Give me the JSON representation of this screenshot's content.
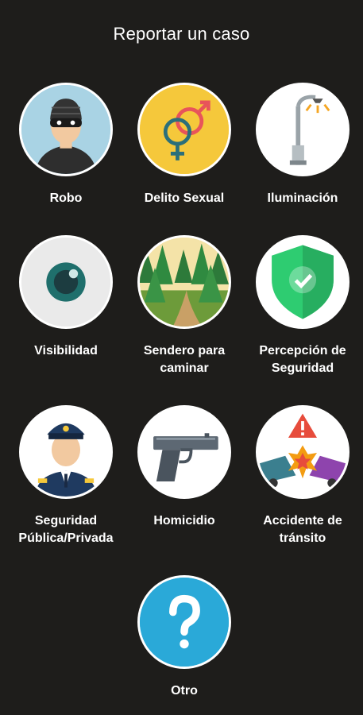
{
  "page": {
    "title": "Reportar un caso"
  },
  "categories": [
    {
      "label": "Robo",
      "icon": "thief-icon",
      "bg": "#a9d3e4"
    },
    {
      "label": "Delito Sexual",
      "icon": "gender-symbols-icon",
      "bg": "#f5c83b"
    },
    {
      "label": "Iluminación",
      "icon": "street-lamp-icon",
      "bg": "#ffffff"
    },
    {
      "label": "Visibilidad",
      "icon": "eye-icon",
      "bg": "#eaeaea"
    },
    {
      "label": "Sendero para\ncaminar",
      "icon": "forest-path-icon",
      "bg": "#f2d89a"
    },
    {
      "label": "Percepción de\nSeguridad",
      "icon": "shield-check-icon",
      "bg": "#ffffff"
    },
    {
      "label": "Seguridad\nPública/Privada",
      "icon": "police-officer-icon",
      "bg": "#ffffff"
    },
    {
      "label": "Homicidio",
      "icon": "pistol-icon",
      "bg": "#ffffff"
    },
    {
      "label": "Accidente de\ntránsito",
      "icon": "car-crash-icon",
      "bg": "#ffffff"
    },
    {
      "label": "Otro",
      "icon": "question-mark-icon",
      "bg": "#2aa9d8"
    }
  ]
}
